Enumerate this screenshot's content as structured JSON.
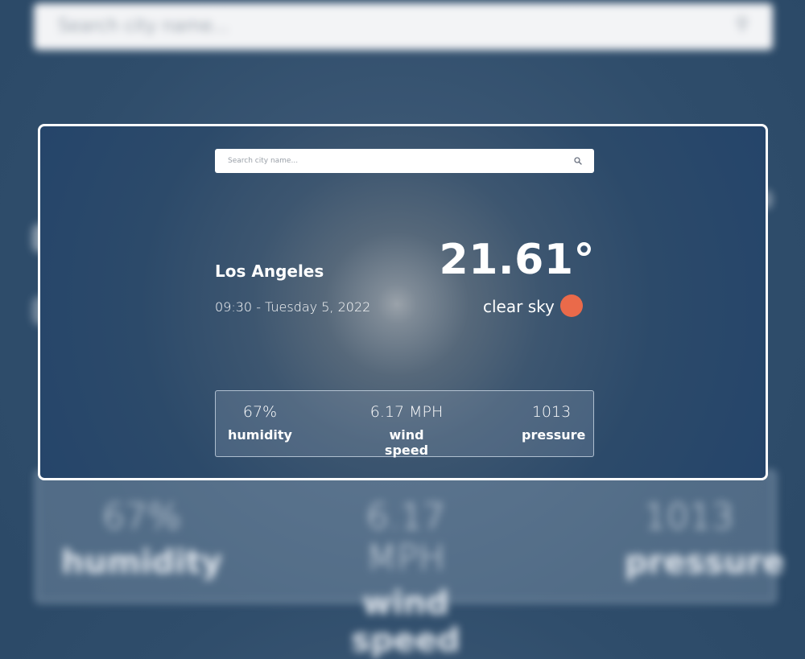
{
  "search": {
    "placeholder": "Search city name...",
    "icon": "search-icon"
  },
  "weather": {
    "city": "Los Angeles",
    "datetime": "09:30 - Tuesday 5, 2022",
    "temperature": "21.61°",
    "condition": "clear sky",
    "condition_icon": "sun-icon",
    "condition_icon_color": "#ea6a4a"
  },
  "stats": [
    {
      "value": "67%",
      "label": "humidity"
    },
    {
      "value": "6.17 MPH",
      "label": "wind speed"
    },
    {
      "value": "1013",
      "label": "pressure"
    }
  ],
  "colors": {
    "background": "#2a4866",
    "card_border": "#ffffff",
    "text": "#ffffff"
  }
}
